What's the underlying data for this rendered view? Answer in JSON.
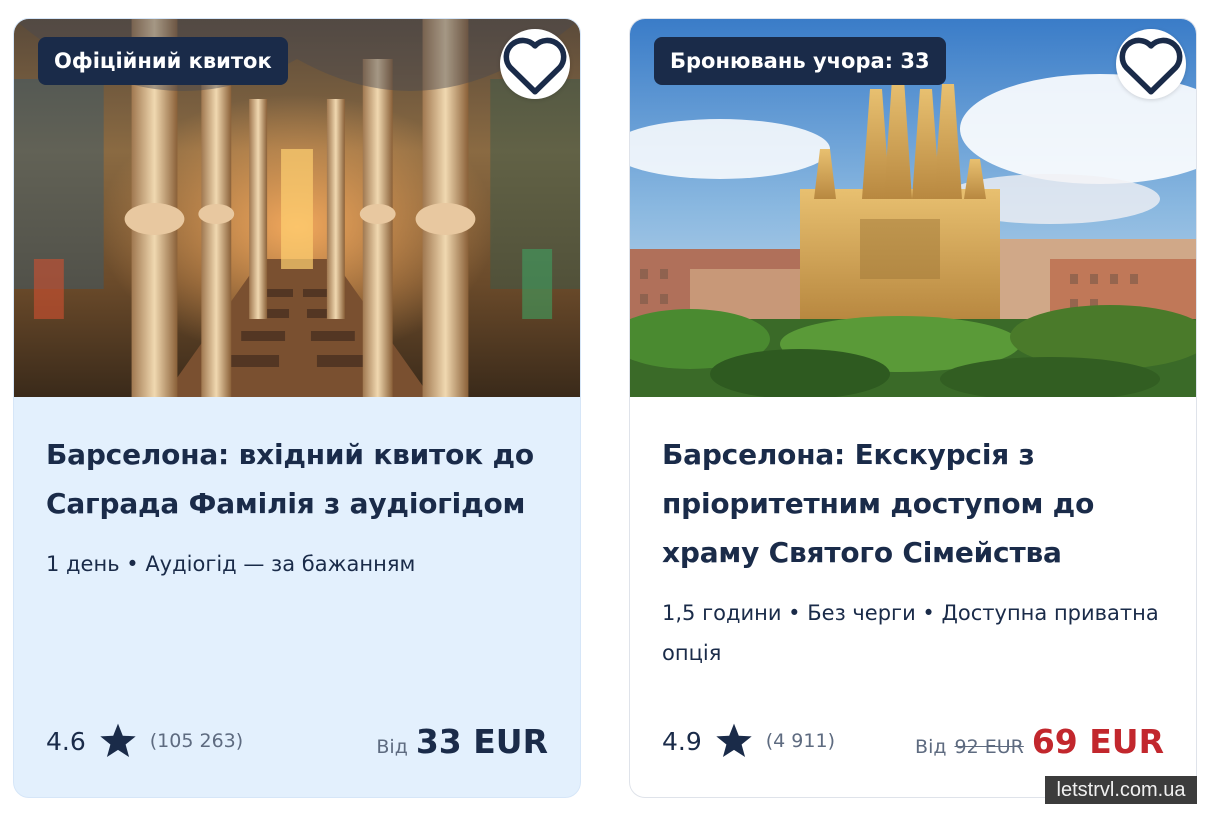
{
  "cards": [
    {
      "badge": "Офіційний квиток",
      "title": "Барселона: вхідний квиток до Саграда Фамілія з аудіогідом",
      "meta": "1 день • Аудіогід — за бажанням",
      "rating": "4.6",
      "reviews": "(105 263)",
      "price_from": "Від",
      "price": "33 EUR"
    },
    {
      "badge": "Бронювань учора: 33",
      "title": "Барселона: Екскурсія з пріоритетним доступом до храму Святого Сімейства",
      "meta": "1,5 години • Без черги • Доступна приватна опція",
      "rating": "4.9",
      "reviews": "(4 911)",
      "price_from": "Від",
      "price_old": "92 EUR",
      "price": "69 EUR"
    }
  ],
  "watermark": "letstrvl.com.ua",
  "icons": {
    "favorite": "heart-icon",
    "rating": "star-icon"
  },
  "colors": {
    "navy": "#1a2b49",
    "sale_red": "#c2272d",
    "highlight_card_bg": "#e3f0fd"
  }
}
